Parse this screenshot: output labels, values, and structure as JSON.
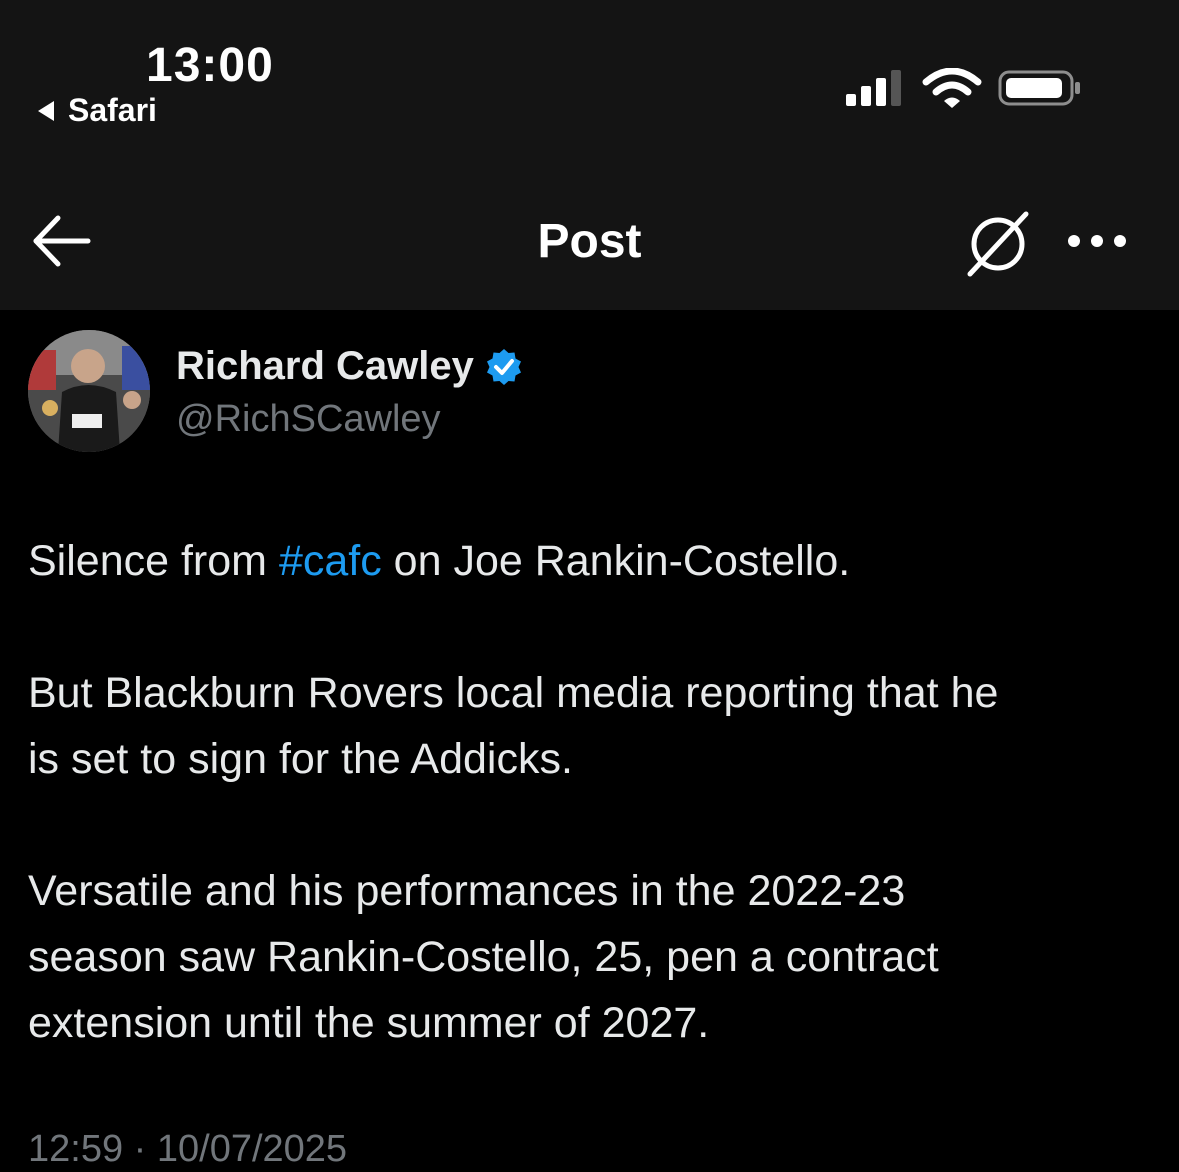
{
  "status_bar": {
    "time": "13:00",
    "back_app": "Safari",
    "signal_icon": "cellular-signal-icon",
    "wifi_icon": "wifi-icon",
    "battery_icon": "battery-icon"
  },
  "nav": {
    "title": "Post",
    "back_icon": "arrow-left-icon",
    "grok_icon": "grok-icon",
    "more_icon": "more-options-icon"
  },
  "author": {
    "name": "Richard Cawley",
    "handle": "@RichSCawley",
    "verified": true
  },
  "tweet": {
    "p1_before": "Silence from ",
    "p1_hashtag": "#cafc",
    "p1_after": " on Joe Rankin-Costello.",
    "p2_line1": "But Blackburn Rovers local media reporting that he",
    "p2_line2": "is set to sign for the Addicks.",
    "p3_line1": "Versatile and his performances in the 2022-23",
    "p3_line2": "season saw Rankin-Costello, 25, pen a contract",
    "p3_line3": "extension until the summer of 2027."
  },
  "timestamp": "12:59 · 10/07/2025",
  "colors": {
    "background": "#000000",
    "header": "#141414",
    "text": "#e7e9ea",
    "secondary": "#71767b",
    "accent": "#1d9bf0"
  }
}
